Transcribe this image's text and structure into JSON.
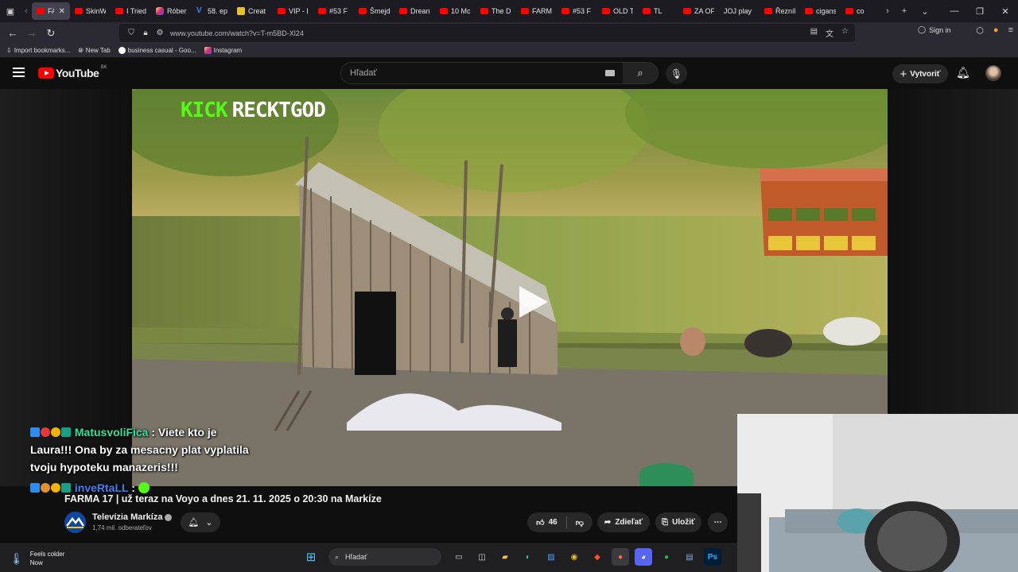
{
  "browser": {
    "tabs": [
      {
        "label": "FAR",
        "icon": "youtube-icon",
        "active": true
      },
      {
        "label": "SkinW",
        "icon": "youtube-icon"
      },
      {
        "label": "I Tried",
        "icon": "youtube-icon"
      },
      {
        "label": "Róber",
        "icon": "instagram-icon"
      },
      {
        "label": "58. ep",
        "icon": "v-icon"
      },
      {
        "label": "Creat",
        "icon": "doc-icon"
      },
      {
        "label": "VIP - I",
        "icon": "youtube-icon"
      },
      {
        "label": "#53 F",
        "icon": "youtube-icon"
      },
      {
        "label": "Šmejd",
        "icon": "youtube-icon"
      },
      {
        "label": "Drean",
        "icon": "youtube-icon"
      },
      {
        "label": "10 Mc",
        "icon": "youtube-icon"
      },
      {
        "label": "The D",
        "icon": "youtube-icon"
      },
      {
        "label": "FARM",
        "icon": "youtube-icon"
      },
      {
        "label": "#53 F",
        "icon": "youtube-icon"
      },
      {
        "label": "OLD T",
        "icon": "youtube-icon"
      },
      {
        "label": "TL",
        "icon": "youtube-icon"
      },
      {
        "label": "ZA OF",
        "icon": "youtube-icon"
      },
      {
        "label": "JOJ play",
        "icon": "none"
      },
      {
        "label": "Řezníl",
        "icon": "youtube-icon"
      },
      {
        "label": "cigans",
        "icon": "youtube-icon"
      },
      {
        "label": "co",
        "icon": "youtube-icon"
      }
    ],
    "url": "www.youtube.com/watch?v=T-m5BD-Xl24",
    "sign_in": "Sign in",
    "bookmarks": [
      "Import bookmarks...",
      "New Tab",
      "business casual - Goo...",
      "Instagram"
    ]
  },
  "youtube": {
    "logo_word": "YouTube",
    "country": "SK",
    "search_placeholder": "Hľadať",
    "create_label": "Vytvoriť"
  },
  "video": {
    "overlay_tag_kick": "KICK",
    "overlay_tag_name": "RECKTGOD",
    "title": "FARMA 17 | už teraz na Voyo a dnes 21. 11. 2025 o 20:30 na Markíze",
    "channel": "Televízia Markíza",
    "subscribers": "1,74 mil. odberateľov",
    "likes": "46",
    "share_label": "Zdieľať",
    "save_label": "Uložiť"
  },
  "chat": [
    {
      "user": "MatusvoliFica",
      "text": " : Viete kto je Laura!!! Ona by za mesacny plat vyplatila tvoju hypoteku manazeris!!!"
    },
    {
      "user": "inveRtaLL",
      "text": " :"
    }
  ],
  "taskbar": {
    "weather_title": "Feels colder",
    "weather_sub": "Now",
    "search_label": "Hľadať"
  },
  "colors": {
    "youtube_red": "#ff0000",
    "kick_green": "#53fc18",
    "chat_user1": "#2ee59d",
    "chat_user2": "#3b82f6"
  }
}
